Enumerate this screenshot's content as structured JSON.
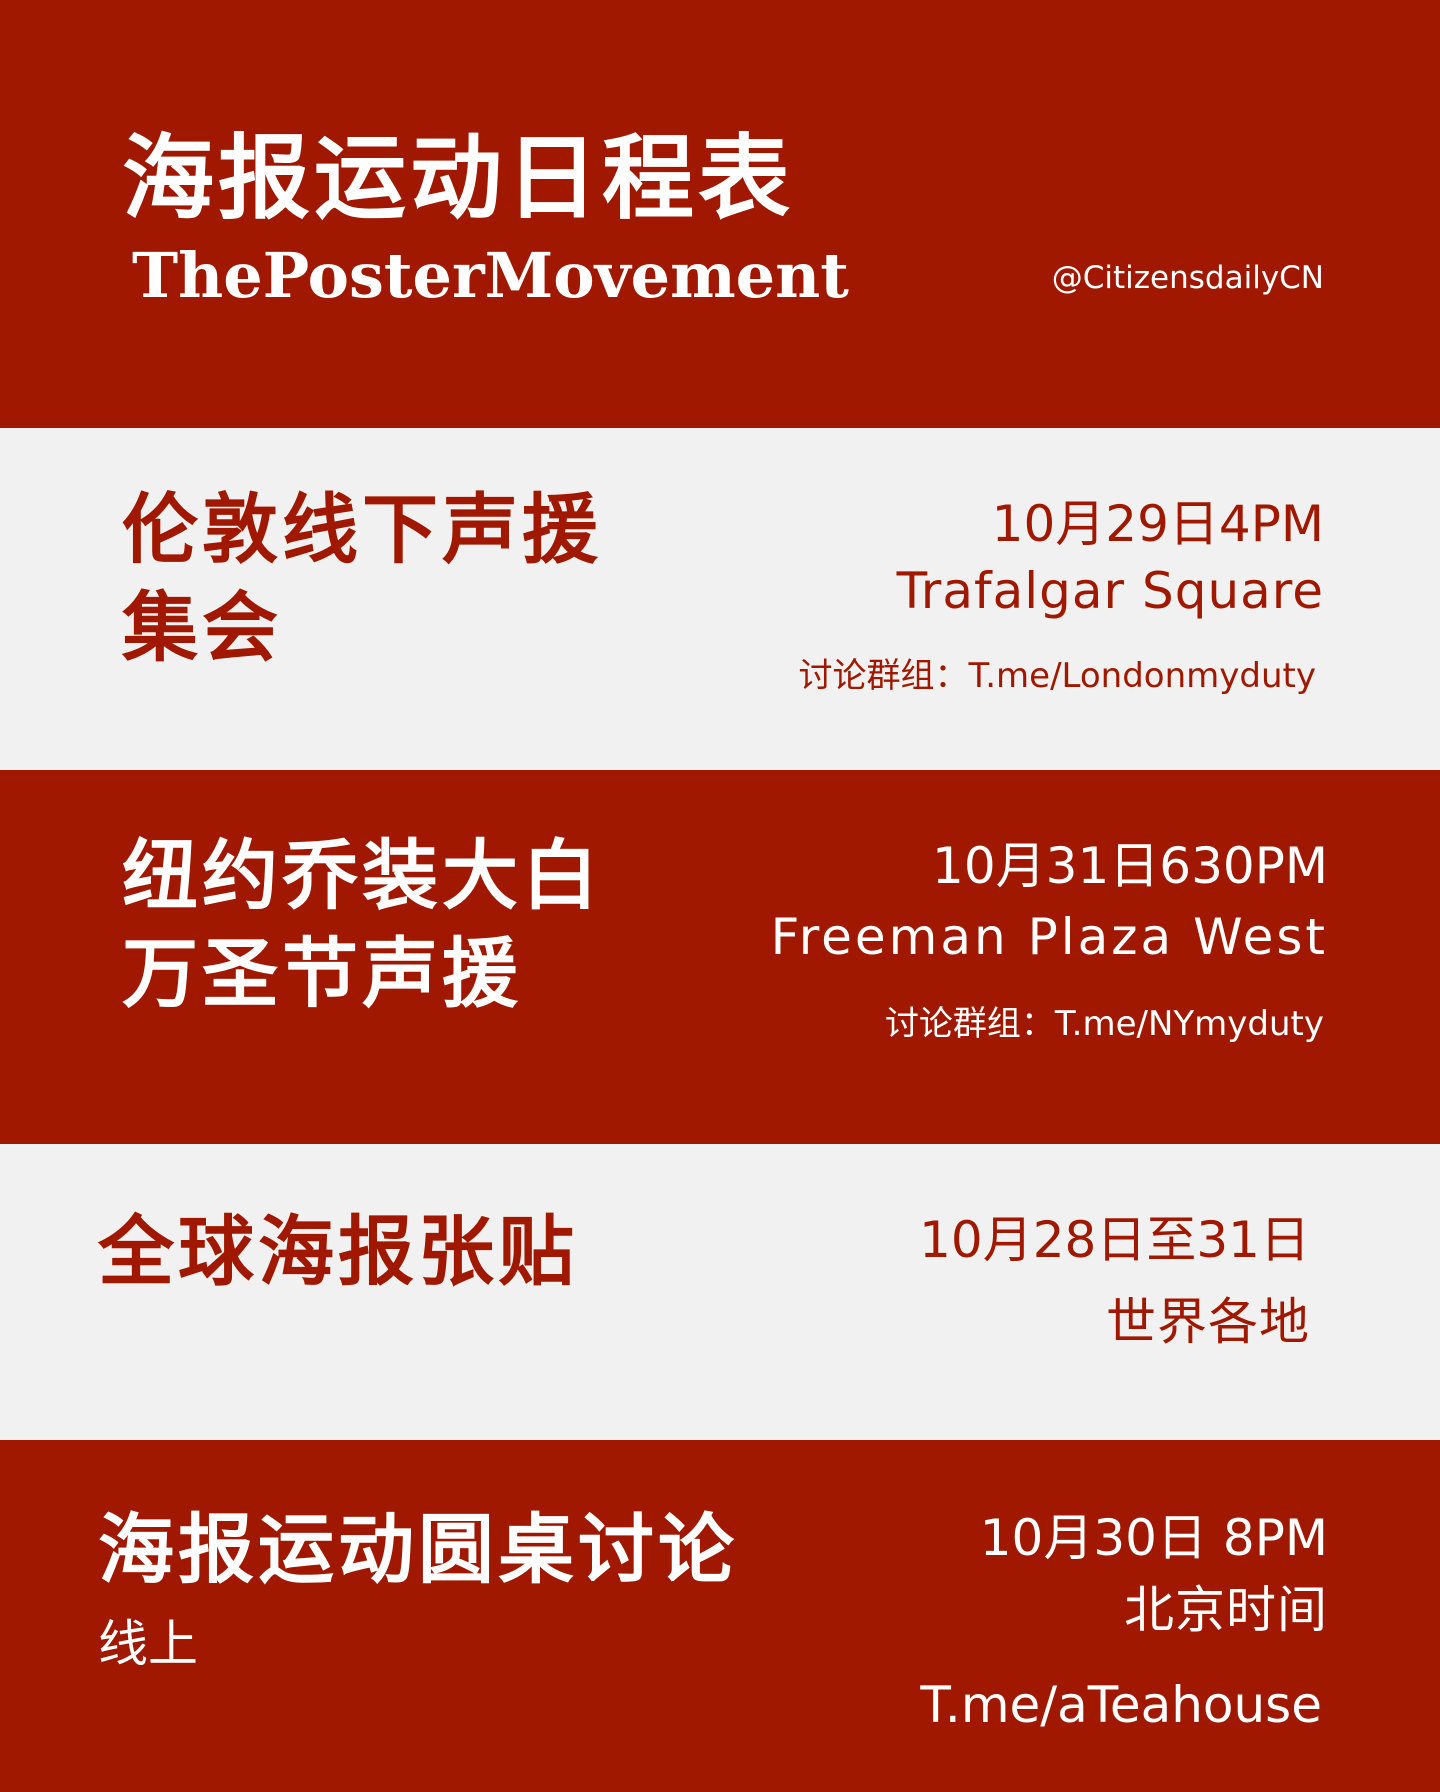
{
  "header": {
    "title_cn": "海报运动日程表",
    "title_en": "ThePosterMovement",
    "handle": "@CitizensdailyCN"
  },
  "events": [
    {
      "title_line1": "伦敦线下声援",
      "title_line2": "集会",
      "date": "10月29日4PM",
      "place": "Trafalgar Square",
      "group": "讨论群组：T.me/Londonmyduty"
    },
    {
      "title_line1": "纽约乔装大白",
      "title_line2": "万圣节声援",
      "date": "10月31日630PM",
      "place": "Freeman Plaza West",
      "group": "讨论群组：T.me/NYmyduty"
    },
    {
      "title_line1": "全球海报张贴",
      "date": "10月28日至31日",
      "place": "世界各地"
    },
    {
      "title_line1": "海报运动圆桌讨论",
      "note": "线上",
      "date": "10月30日 8PM",
      "place": "北京时间",
      "link": "T.me/aTeahouse"
    }
  ],
  "colors": {
    "red": "#a01800",
    "light": "#f2f1f1",
    "white": "#ffffff"
  }
}
